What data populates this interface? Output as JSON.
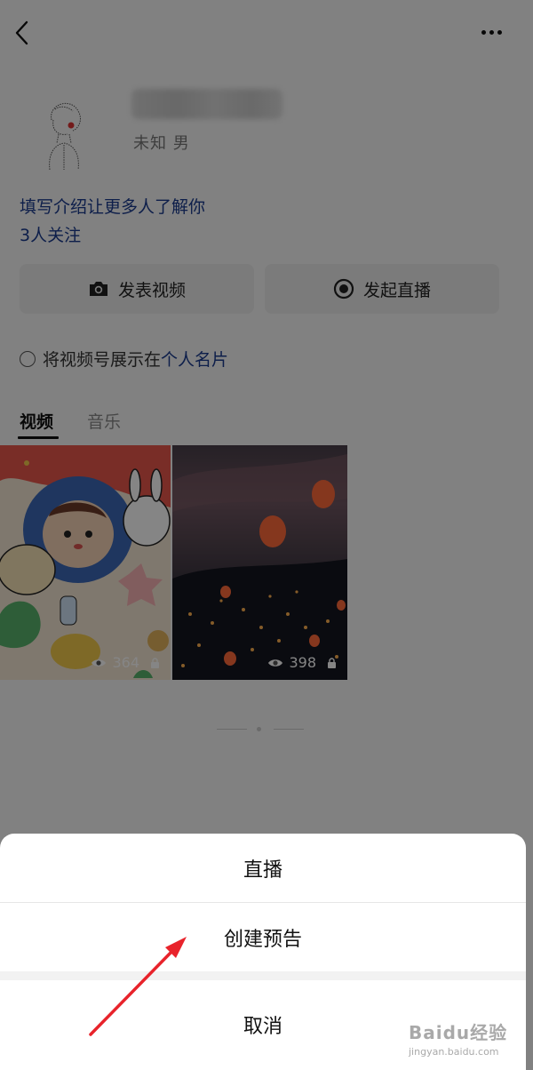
{
  "nav": {
    "back_icon": "chevron-left-icon",
    "more_icon": "more-dots-icon"
  },
  "profile": {
    "gender_line": "未知 男",
    "intro_link": "填写介绍让更多人了解你",
    "follow_count": "3人关注"
  },
  "actions": {
    "post_video": {
      "label": "发表视频",
      "icon": "camera-icon"
    },
    "start_live": {
      "label": "发起直播",
      "icon": "record-icon"
    }
  },
  "show_in_card": {
    "prefix": "将视频号展示在",
    "link": "个人名片",
    "checked": false
  },
  "tabs": [
    {
      "label": "视频",
      "active": true
    },
    {
      "label": "音乐",
      "active": false
    }
  ],
  "videos": [
    {
      "views": "364",
      "locked": true
    },
    {
      "views": "398",
      "locked": true
    }
  ],
  "bottom_sheet": {
    "items": [
      "直播",
      "创建预告"
    ],
    "cancel": "取消"
  },
  "watermark": {
    "brand": "Baidu经验",
    "url": "jingyan.baidu.com"
  },
  "colors": {
    "link": "#1a3b8f",
    "arrow": "#e8232b",
    "overlay": "rgba(0,0,0,0.48)"
  }
}
